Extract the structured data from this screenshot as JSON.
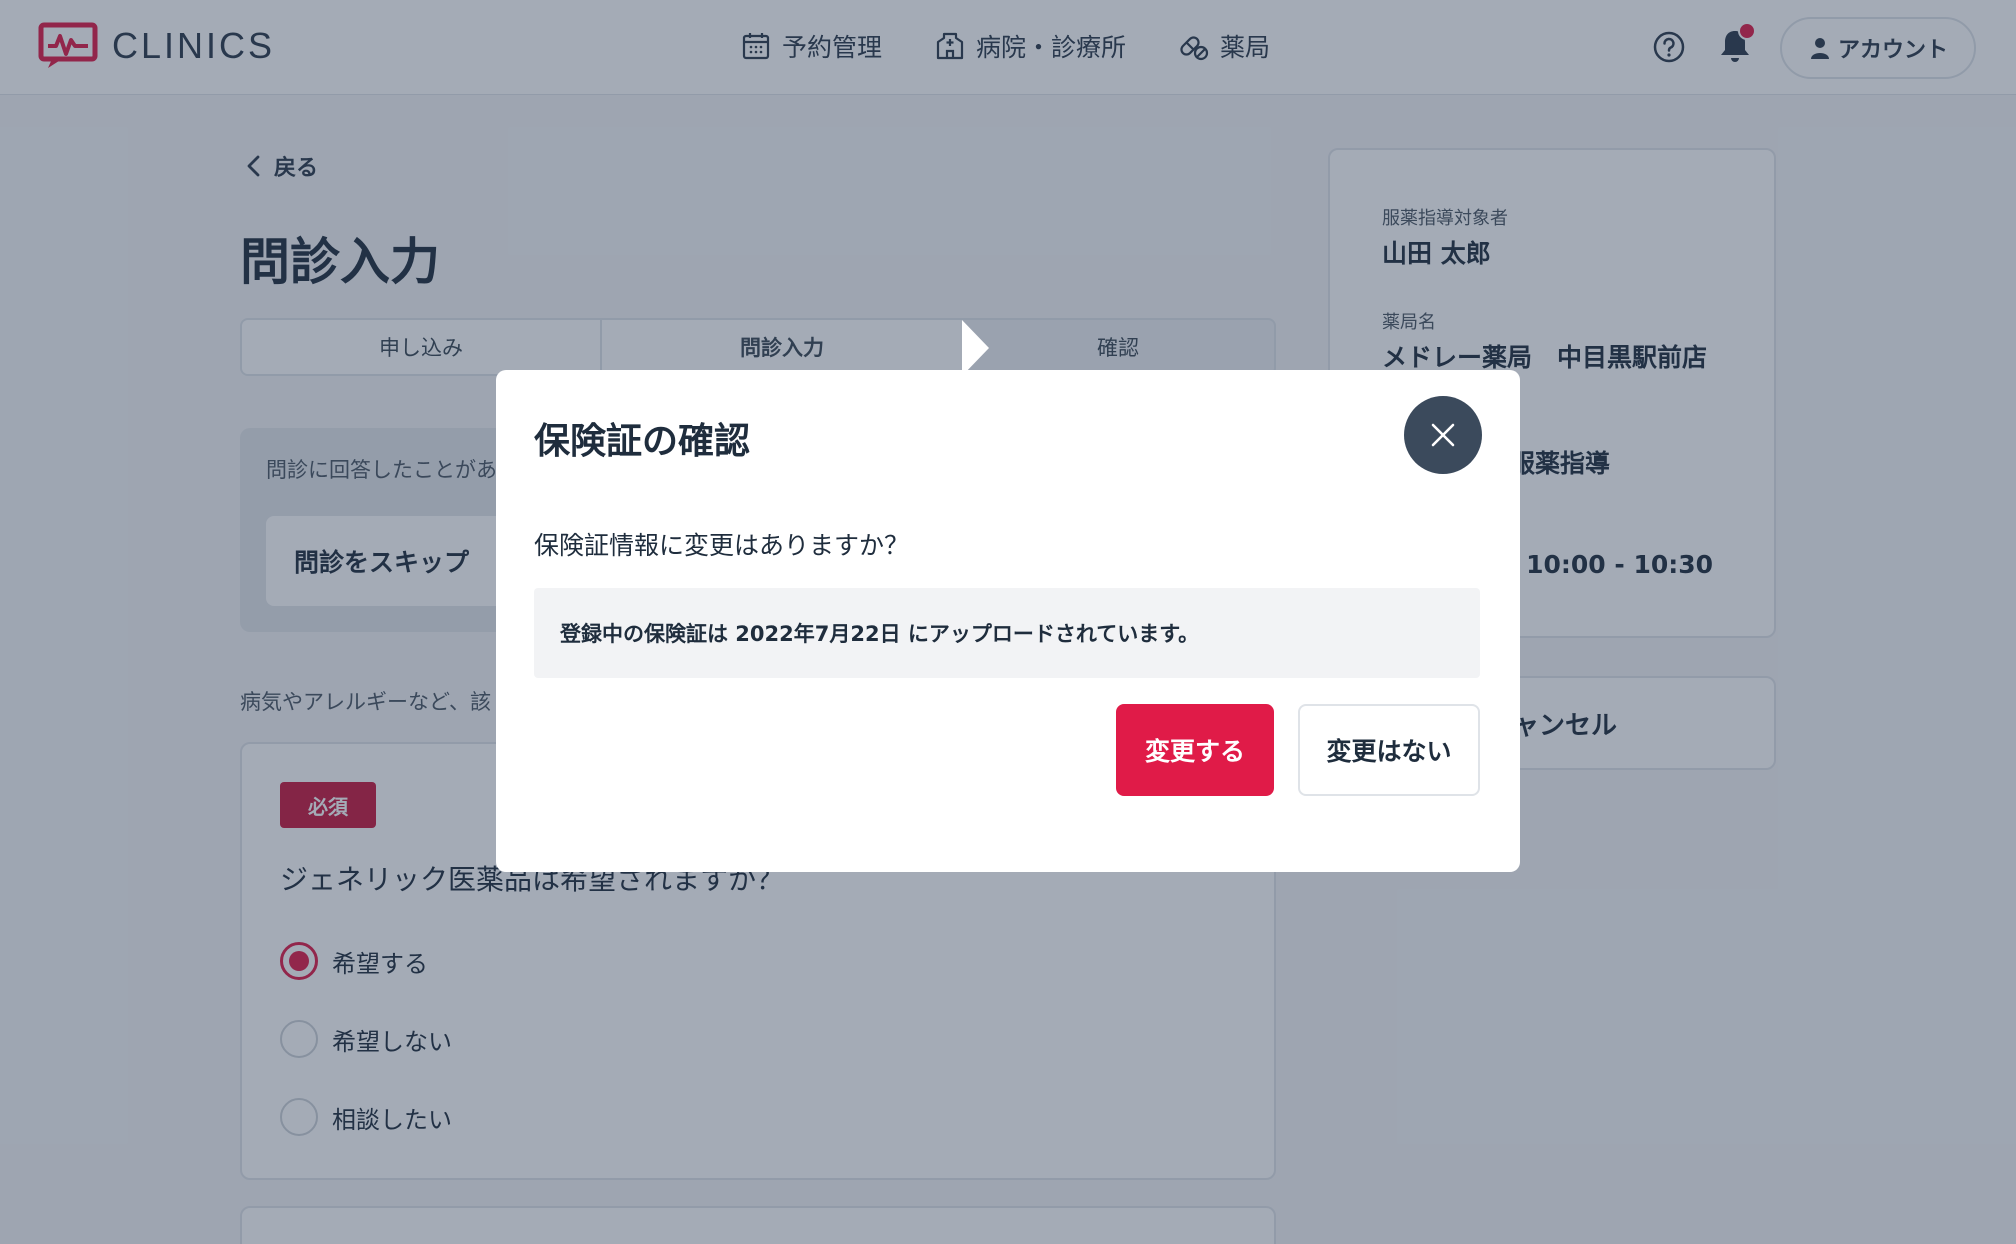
{
  "header": {
    "brand": "CLINICS",
    "nav": [
      {
        "label": "予約管理",
        "icon": "calendar-icon"
      },
      {
        "label": "病院・診療所",
        "icon": "hospital-icon"
      },
      {
        "label": "薬局",
        "icon": "pill-icon"
      }
    ],
    "account_label": "アカウント",
    "notification_badge_color": "#e01b48"
  },
  "main": {
    "back_label": "戻る",
    "title": "問診入力",
    "steps": [
      "申し込み",
      "問診入力",
      "確認"
    ],
    "active_step": "問診入力",
    "skip_panel": {
      "text": "問診に回答したことがあ",
      "button": "問診をスキップ"
    },
    "note": "病気やアレルギーなど、該",
    "question_card": {
      "badge": "必須",
      "question": "ジェネリック医薬品は希望されますか？",
      "options": [
        "希望する",
        "希望しない",
        "相談したい"
      ],
      "selected": "希望する"
    }
  },
  "sidebar": {
    "fields": [
      {
        "label": "服薬指導対象者",
        "value": "山田 太郎"
      },
      {
        "label": "薬局名",
        "value": "メドレー薬局　中目黒駅前店"
      },
      {
        "label": "",
        "value": "服薬指導"
      },
      {
        "label": "",
        "value": ") 10:00 - 10:30"
      }
    ],
    "cancel_label": "キャンセル"
  },
  "modal": {
    "title": "保険証の確認",
    "question": "保険証情報に変更はありますか？",
    "info": "登録中の保険証は 2022年7月22日 にアップロードされています。",
    "primary_button": "変更する",
    "secondary_button": "変更はない"
  },
  "colors": {
    "accent": "#e01b48",
    "badge": "#c8193f",
    "text": "#1f2d3d",
    "close_button": "#3b4a5c"
  }
}
